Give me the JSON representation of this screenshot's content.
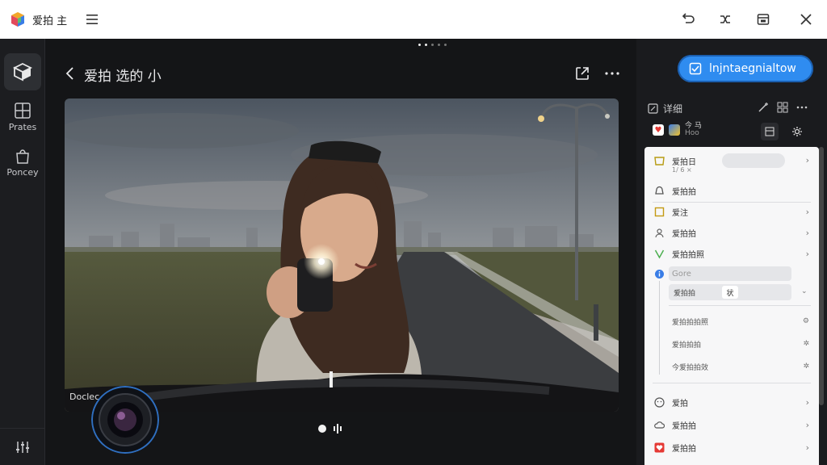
{
  "window": {
    "title": "爱拍 主",
    "controls": [
      "undo-icon",
      "gesture-icon",
      "window-icon",
      "close-icon"
    ]
  },
  "rail": {
    "items": [
      {
        "label": "Prates",
        "icon": "grid-icon"
      },
      {
        "label": "Poncey",
        "icon": "bag-icon"
      }
    ]
  },
  "viewer": {
    "title": "爱拍 选的 小",
    "photo_caption": "Doclec",
    "page_dots": 5,
    "active_dot": 1
  },
  "panel": {
    "cta_label": "lnjntaegnialtow",
    "section_label": "详细",
    "row2_text": "今 马",
    "row2_sub": "Hoo"
  },
  "menu": {
    "items": [
      {
        "label": "爱拍日",
        "sub": "1/ 6 ×",
        "icon": "tag-icon",
        "chev": "›"
      },
      {
        "label": "爱拍拍",
        "icon": "bell-icon",
        "chev": ""
      },
      {
        "label": "爱注",
        "icon": "note-icon",
        "chev": "›"
      },
      {
        "label": "爱拍拍",
        "icon": "user-icon",
        "chev": "›"
      },
      {
        "label": "爱拍拍照",
        "icon": "shield-icon",
        "chev": "›"
      },
      {
        "label": "Gore",
        "icon": "info-icon",
        "chev": ""
      }
    ],
    "submenu": {
      "highlighted": "爱拍拍",
      "chip": "状",
      "rows": [
        "爱拍拍拍照",
        "爱拍拍拍",
        "今爱拍拍效"
      ]
    },
    "bottom": [
      {
        "label": "爱拍",
        "icon": "mood-icon",
        "chev": "›"
      },
      {
        "label": "爱拍拍",
        "icon": "cloud-icon",
        "chev": "›"
      },
      {
        "label": "爱拍拍",
        "icon": "heart-icon",
        "chev": "›"
      }
    ]
  },
  "colors": {
    "accent": "#2f8cf0",
    "rail_bg": "#1c1d20",
    "panel_bg": "#1a1b1e",
    "menu_bg": "#f7f7f8"
  }
}
